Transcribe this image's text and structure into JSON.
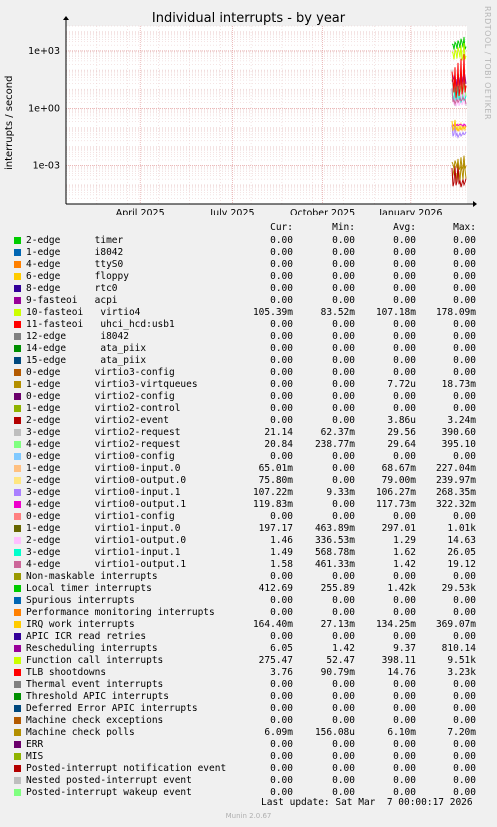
{
  "title": "Individual interrupts - by year",
  "ylabel": "interrupts / second",
  "watermark": "RRDTOOL / TOBI OETIKER",
  "footer": "Munin 2.0.67",
  "last_update": "Last update: Sat Mar  7 00:00:17 2026",
  "columns": [
    "Cur:",
    "Min:",
    "Avg:",
    "Max:"
  ],
  "chart_data": {
    "type": "line",
    "title": "Individual interrupts - by year",
    "ylabel": "interrupts / second",
    "yscale": "log",
    "ylim": [
      1e-05,
      20000
    ],
    "yticks": [
      {
        "label": "1e+03",
        "value": 1000
      },
      {
        "label": "1e+00",
        "value": 1
      },
      {
        "label": "1e-03",
        "value": 0.001
      }
    ],
    "xticks": [
      "April 2025",
      "July 2025",
      "October 2025",
      "January 2026"
    ],
    "grid": true,
    "series_summary": "data present only in the last weeks (from ~February 2026)"
  },
  "legend": [
    {
      "name": "2-edge      timer",
      "color": "#00cc00",
      "cur": "0.00",
      "min": "0.00",
      "avg": "0.00",
      "max": "0.00"
    },
    {
      "name": "1-edge      i8042",
      "color": "#0066b3",
      "cur": "0.00",
      "min": "0.00",
      "avg": "0.00",
      "max": "0.00"
    },
    {
      "name": "4-edge      ttyS0",
      "color": "#ff8000",
      "cur": "0.00",
      "min": "0.00",
      "avg": "0.00",
      "max": "0.00"
    },
    {
      "name": "6-edge      floppy",
      "color": "#ffcc00",
      "cur": "0.00",
      "min": "0.00",
      "avg": "0.00",
      "max": "0.00"
    },
    {
      "name": "8-edge      rtc0",
      "color": "#330099",
      "cur": "0.00",
      "min": "0.00",
      "avg": "0.00",
      "max": "0.00"
    },
    {
      "name": "9-fasteoi   acpi",
      "color": "#990099",
      "cur": "0.00",
      "min": "0.00",
      "avg": "0.00",
      "max": "0.00"
    },
    {
      "name": "10-fasteoi   virtio4",
      "color": "#ccff00",
      "cur": "105.39m",
      "min": "83.52m",
      "avg": "107.18m",
      "max": "178.09m"
    },
    {
      "name": "11-fasteoi   uhci_hcd:usb1",
      "color": "#ff0000",
      "cur": "0.00",
      "min": "0.00",
      "avg": "0.00",
      "max": "0.00"
    },
    {
      "name": "12-edge      i8042",
      "color": "#808080",
      "cur": "0.00",
      "min": "0.00",
      "avg": "0.00",
      "max": "0.00"
    },
    {
      "name": "14-edge      ata_piix",
      "color": "#008f00",
      "cur": "0.00",
      "min": "0.00",
      "avg": "0.00",
      "max": "0.00"
    },
    {
      "name": "15-edge      ata_piix",
      "color": "#00487d",
      "cur": "0.00",
      "min": "0.00",
      "avg": "0.00",
      "max": "0.00"
    },
    {
      "name": "0-edge      virtio3-config",
      "color": "#b35a00",
      "cur": "0.00",
      "min": "0.00",
      "avg": "0.00",
      "max": "0.00"
    },
    {
      "name": "1-edge      virtio3-virtqueues",
      "color": "#b38f00",
      "cur": "0.00",
      "min": "0.00",
      "avg": "7.72u",
      "max": "18.73m"
    },
    {
      "name": "0-edge      virtio2-config",
      "color": "#6b006b",
      "cur": "0.00",
      "min": "0.00",
      "avg": "0.00",
      "max": "0.00"
    },
    {
      "name": "1-edge      virtio2-control",
      "color": "#8fb300",
      "cur": "0.00",
      "min": "0.00",
      "avg": "0.00",
      "max": "0.00"
    },
    {
      "name": "2-edge      virtio2-event",
      "color": "#b30000",
      "cur": "0.00",
      "min": "0.00",
      "avg": "3.86u",
      "max": "3.24m"
    },
    {
      "name": "3-edge      virtio2-request",
      "color": "#bebebe",
      "cur": "21.14",
      "min": "62.37m",
      "avg": "29.56",
      "max": "390.60"
    },
    {
      "name": "4-edge      virtio2-request",
      "color": "#80ff80",
      "cur": "20.84",
      "min": "238.77m",
      "avg": "29.64",
      "max": "395.10"
    },
    {
      "name": "0-edge      virtio0-config",
      "color": "#80c9ff",
      "cur": "0.00",
      "min": "0.00",
      "avg": "0.00",
      "max": "0.00"
    },
    {
      "name": "1-edge      virtio0-input.0",
      "color": "#ffc080",
      "cur": "65.01m",
      "min": "0.00",
      "avg": "68.67m",
      "max": "227.04m"
    },
    {
      "name": "2-edge      virtio0-output.0",
      "color": "#ffe680",
      "cur": "75.80m",
      "min": "0.00",
      "avg": "79.00m",
      "max": "239.97m"
    },
    {
      "name": "3-edge      virtio0-input.1",
      "color": "#aa80ff",
      "cur": "107.22m",
      "min": "9.33m",
      "avg": "106.27m",
      "max": "268.35m"
    },
    {
      "name": "4-edge      virtio0-output.1",
      "color": "#ee00cc",
      "cur": "119.83m",
      "min": "0.00",
      "avg": "117.73m",
      "max": "322.32m"
    },
    {
      "name": "0-edge      virtio1-config",
      "color": "#ff8080",
      "cur": "0.00",
      "min": "0.00",
      "avg": "0.00",
      "max": "0.00"
    },
    {
      "name": "1-edge      virtio1-input.0",
      "color": "#666600",
      "cur": "197.17",
      "min": "463.89m",
      "avg": "297.01",
      "max": "1.01k"
    },
    {
      "name": "2-edge      virtio1-output.0",
      "color": "#ffbfff",
      "cur": "1.46",
      "min": "336.53m",
      "avg": "1.29",
      "max": "14.63"
    },
    {
      "name": "3-edge      virtio1-input.1",
      "color": "#00ffcc",
      "cur": "1.49",
      "min": "568.78m",
      "avg": "1.62",
      "max": "26.05"
    },
    {
      "name": "4-edge      virtio1-output.1",
      "color": "#cc6699",
      "cur": "1.58",
      "min": "461.33m",
      "avg": "1.42",
      "max": "19.12"
    },
    {
      "name": "Non-maskable interrupts",
      "color": "#999900",
      "cur": "0.00",
      "min": "0.00",
      "avg": "0.00",
      "max": "0.00"
    },
    {
      "name": "Local timer interrupts",
      "color": "#00cc00",
      "cur": "412.69",
      "min": "255.89",
      "avg": "1.42k",
      "max": "29.53k"
    },
    {
      "name": "Spurious interrupts",
      "color": "#0066b3",
      "cur": "0.00",
      "min": "0.00",
      "avg": "0.00",
      "max": "0.00"
    },
    {
      "name": "Performance monitoring interrupts",
      "color": "#ff8000",
      "cur": "0.00",
      "min": "0.00",
      "avg": "0.00",
      "max": "0.00"
    },
    {
      "name": "IRQ work interrupts",
      "color": "#ffcc00",
      "cur": "164.40m",
      "min": "27.13m",
      "avg": "134.25m",
      "max": "369.07m"
    },
    {
      "name": "APIC ICR read retries",
      "color": "#330099",
      "cur": "0.00",
      "min": "0.00",
      "avg": "0.00",
      "max": "0.00"
    },
    {
      "name": "Rescheduling interrupts",
      "color": "#990099",
      "cur": "6.05",
      "min": "1.42",
      "avg": "9.37",
      "max": "810.14"
    },
    {
      "name": "Function call interrupts",
      "color": "#ccff00",
      "cur": "275.47",
      "min": "52.47",
      "avg": "398.11",
      "max": "9.51k"
    },
    {
      "name": "TLB shootdowns",
      "color": "#ff0000",
      "cur": "3.76",
      "min": "90.79m",
      "avg": "14.76",
      "max": "3.23k"
    },
    {
      "name": "Thermal event interrupts",
      "color": "#808080",
      "cur": "0.00",
      "min": "0.00",
      "avg": "0.00",
      "max": "0.00"
    },
    {
      "name": "Threshold APIC interrupts",
      "color": "#008f00",
      "cur": "0.00",
      "min": "0.00",
      "avg": "0.00",
      "max": "0.00"
    },
    {
      "name": "Deferred Error APIC interrupts",
      "color": "#00487d",
      "cur": "0.00",
      "min": "0.00",
      "avg": "0.00",
      "max": "0.00"
    },
    {
      "name": "Machine check exceptions",
      "color": "#b35a00",
      "cur": "0.00",
      "min": "0.00",
      "avg": "0.00",
      "max": "0.00"
    },
    {
      "name": "Machine check polls",
      "color": "#b38f00",
      "cur": "6.09m",
      "min": "156.08u",
      "avg": "6.10m",
      "max": "7.20m"
    },
    {
      "name": "ERR",
      "color": "#6b006b",
      "cur": "0.00",
      "min": "0.00",
      "avg": "0.00",
      "max": "0.00"
    },
    {
      "name": "MIS",
      "color": "#8fb300",
      "cur": "0.00",
      "min": "0.00",
      "avg": "0.00",
      "max": "0.00"
    },
    {
      "name": "Posted-interrupt notification event",
      "color": "#b30000",
      "cur": "0.00",
      "min": "0.00",
      "avg": "0.00",
      "max": "0.00"
    },
    {
      "name": "Nested posted-interrupt event",
      "color": "#bebebe",
      "cur": "0.00",
      "min": "0.00",
      "avg": "0.00",
      "max": "0.00"
    },
    {
      "name": "Posted-interrupt wakeup event",
      "color": "#80ff80",
      "cur": "0.00",
      "min": "0.00",
      "avg": "0.00",
      "max": "0.00"
    }
  ]
}
